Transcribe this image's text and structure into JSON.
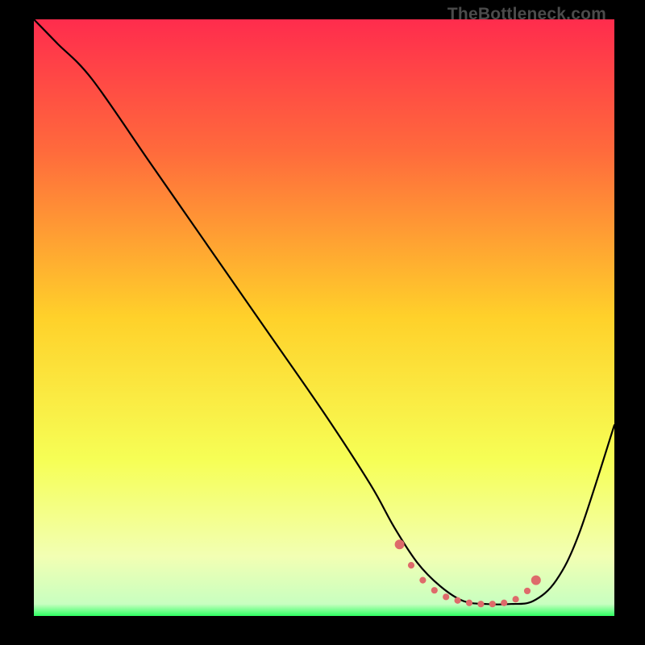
{
  "watermark": "TheBottleneck.com",
  "colors": {
    "gradient_top": "#ff2c4d",
    "gradient_upper_mid": "#ff7a3c",
    "gradient_mid": "#ffd12a",
    "gradient_lower_mid": "#f6ff56",
    "gradient_low": "#f2ffb3",
    "gradient_bottom": "#2eff62",
    "curve_stroke": "#000000",
    "marker_stroke": "#e06a6a",
    "marker_fill": "#dd6b6b",
    "background": "#000000"
  },
  "chart_data": {
    "type": "line",
    "title": "",
    "xlabel": "",
    "ylabel": "",
    "xlim": [
      0,
      100
    ],
    "ylim": [
      0,
      100
    ],
    "series": [
      {
        "name": "bottleneck-curve",
        "x": [
          0,
          4,
          10,
          20,
          30,
          40,
          50,
          58,
          62,
          66,
          70,
          74,
          78,
          82,
          86,
          90,
          94,
          100
        ],
        "y": [
          100,
          96,
          90,
          76,
          62,
          48,
          34,
          22,
          15,
          9,
          5,
          2.5,
          2,
          2,
          2.5,
          6,
          14,
          32
        ]
      }
    ],
    "markers": {
      "name": "optimal-range",
      "x": [
        63,
        65,
        67,
        69,
        71,
        73,
        75,
        77,
        79,
        81,
        83,
        85,
        86.5
      ],
      "y": [
        12,
        8.5,
        6,
        4.3,
        3.2,
        2.6,
        2.2,
        2.0,
        2.0,
        2.2,
        2.8,
        4.2,
        6.0
      ]
    }
  }
}
